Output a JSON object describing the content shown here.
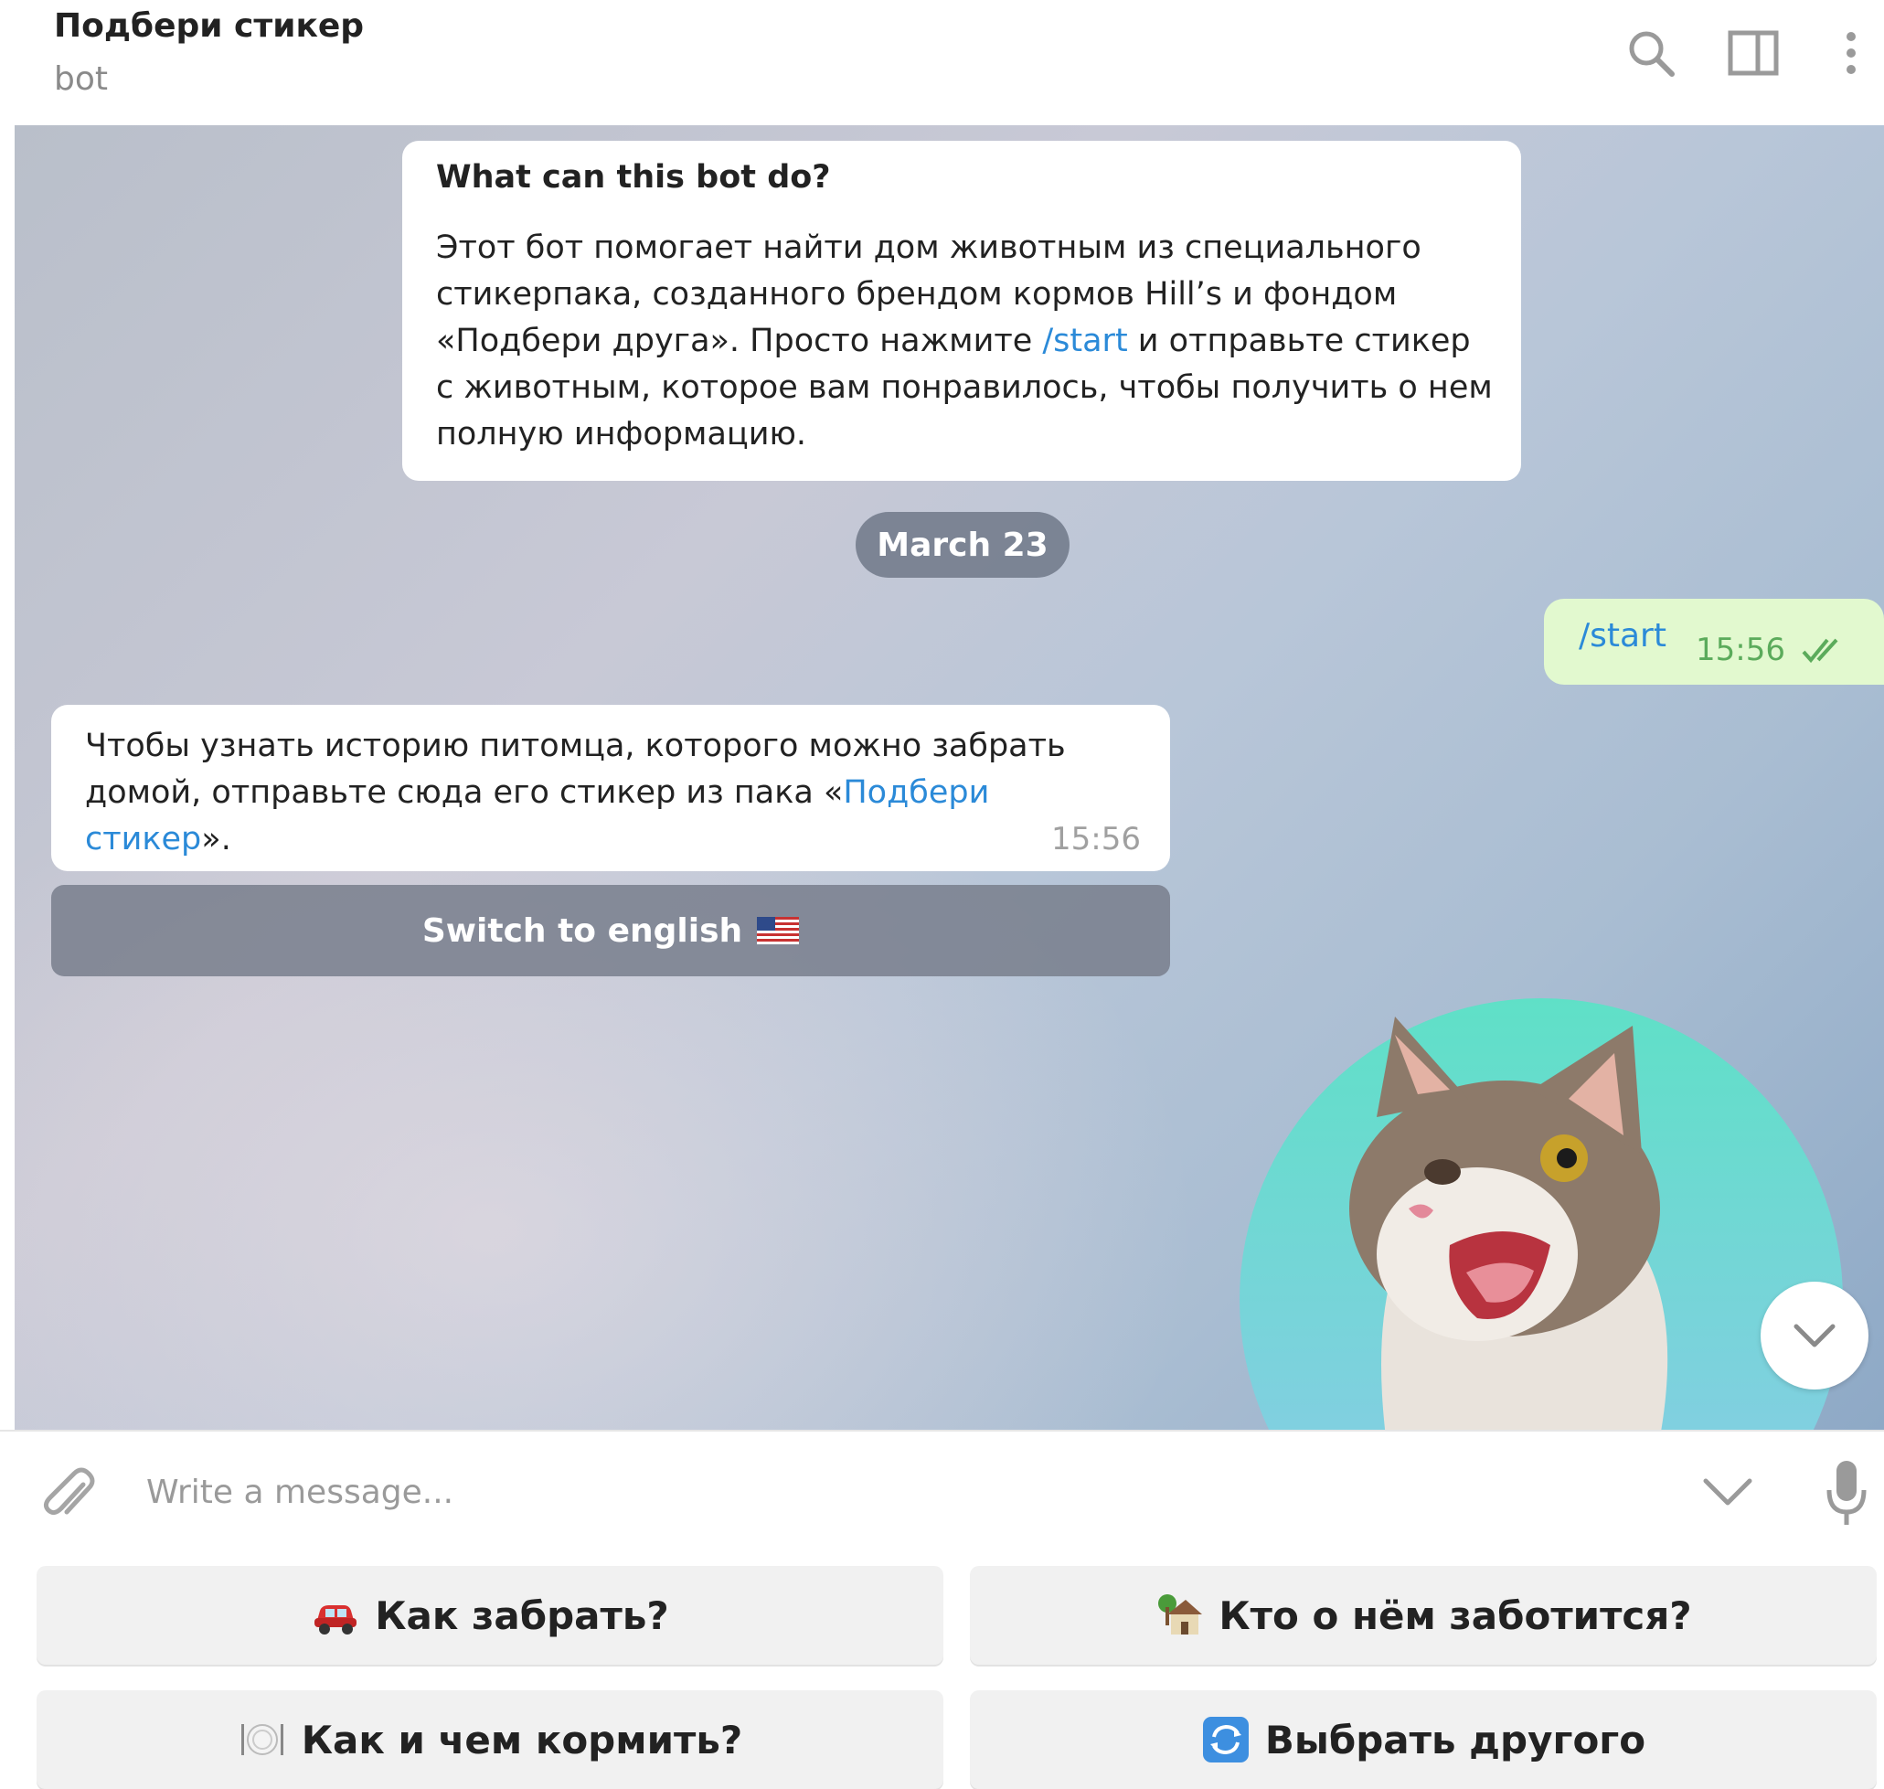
{
  "header": {
    "title": "Подбери стикер",
    "subtitle": "bot",
    "icons": [
      "search-icon",
      "sidebar-toggle-icon",
      "more-options-icon"
    ]
  },
  "intro": {
    "title": "What can this bot do?",
    "body_part1": "Этот бот помогает найти дом животным из специального стикерпака, созданного брендом кормов Hill’s и фондом «Подбери друга». Просто нажмите ",
    "body_link": "/start",
    "body_part2": " и отправьте стикер с животным, которое вам понравилось, чтобы получить о нем полную информацию."
  },
  "date_separator": "March 23",
  "outgoing": {
    "text": "/start",
    "time": "15:56",
    "status": "read"
  },
  "incoming": {
    "text_part1": "Чтобы узнать историю питомца, которого можно забрать домой, отправьте сюда его стикер из пака «",
    "text_link": "Подбери стикер",
    "text_part2": "».",
    "time": "15:56"
  },
  "inline_button": {
    "label": "Switch to english",
    "emoji": "us-flag"
  },
  "sticker": {
    "description_icon": "cat-sticker"
  },
  "composer": {
    "placeholder": "Write a message...",
    "value": ""
  },
  "reply_keyboard": [
    {
      "label": "Как забрать?",
      "emoji": "car-icon"
    },
    {
      "label": "Кто о нём заботится?",
      "emoji": "house-icon"
    },
    {
      "label": "Как и чем кормить?",
      "emoji": "plate-icon"
    },
    {
      "label": "Выбрать другого",
      "emoji": "refresh-icon"
    }
  ],
  "colors": {
    "link": "#2b8ad8",
    "outgoing_bg": "#e2f9cf",
    "outgoing_time": "#5bab5b"
  }
}
